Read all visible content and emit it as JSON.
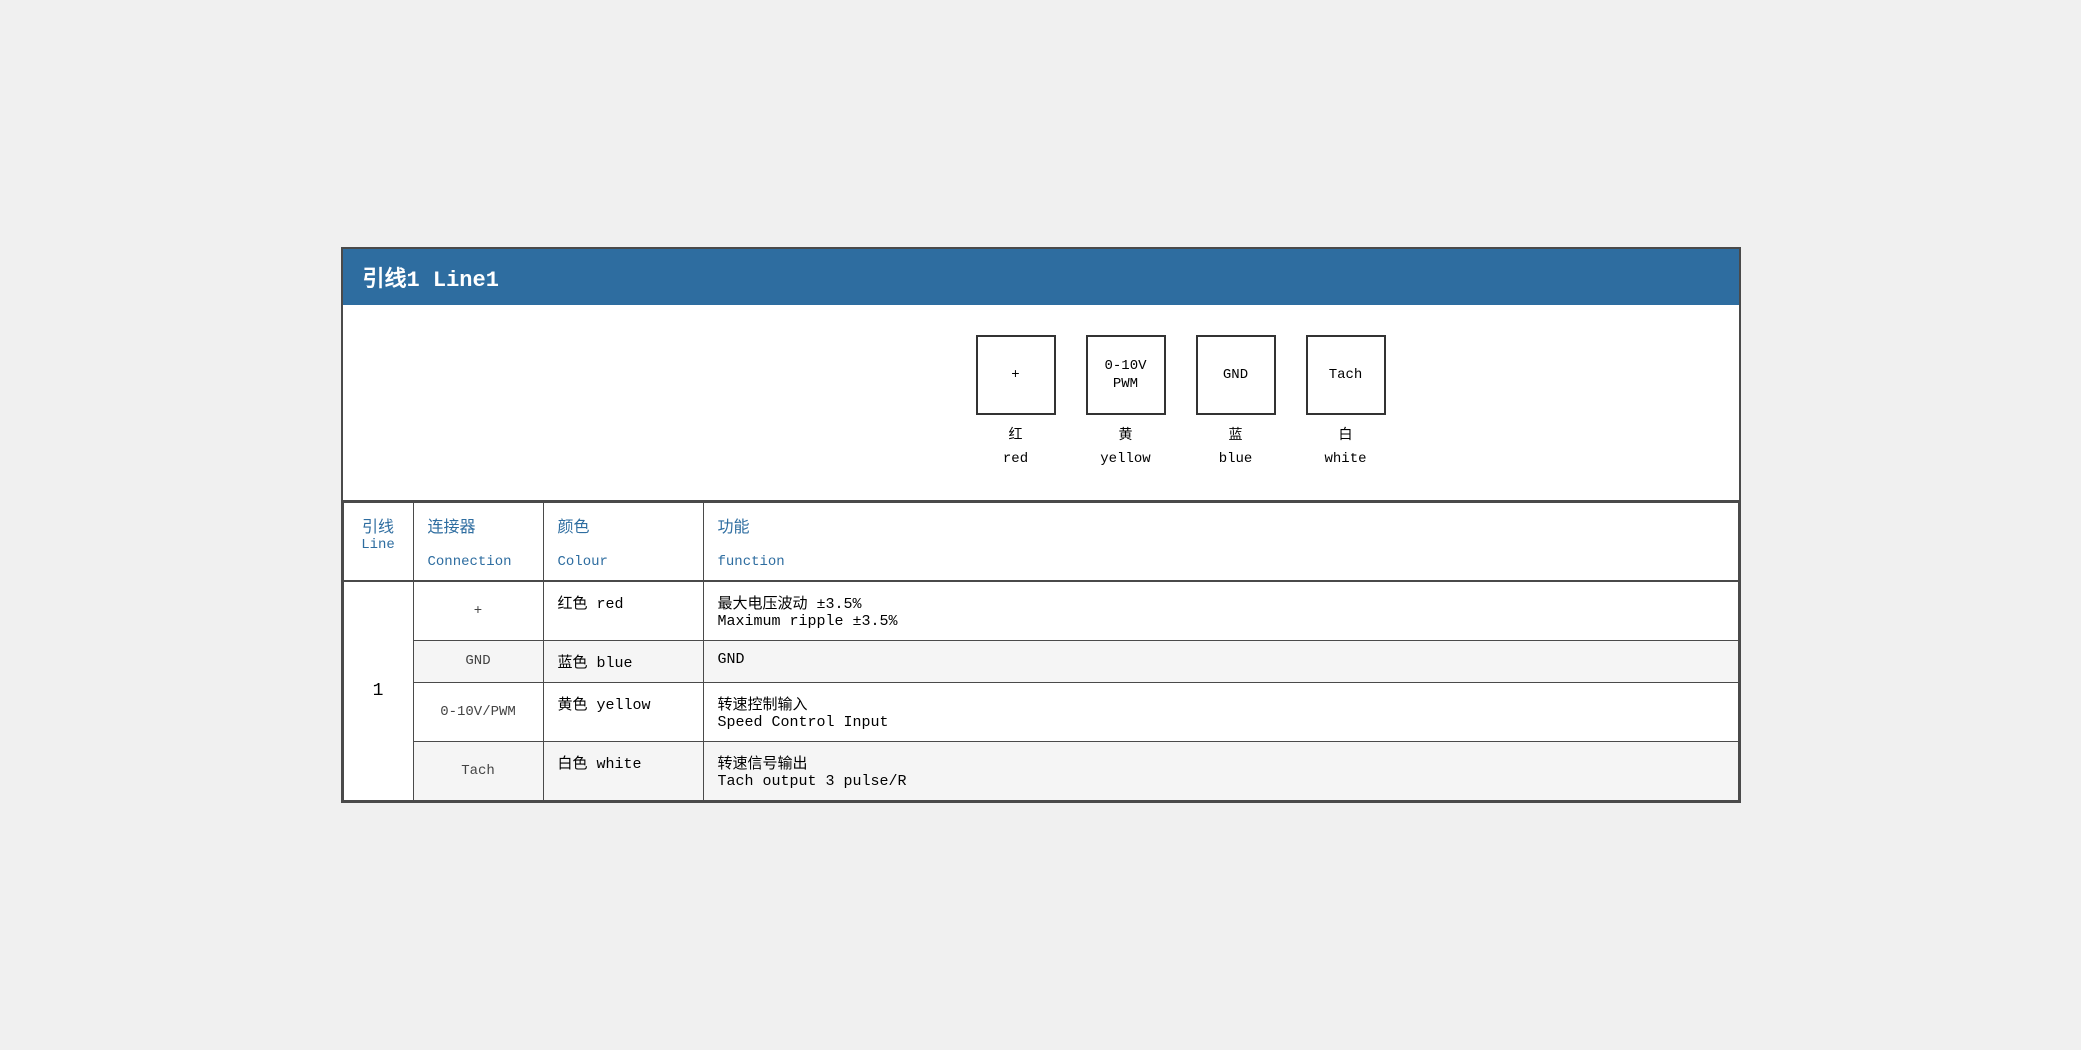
{
  "header": {
    "title": "引线1 Line1"
  },
  "diagram": {
    "boxes": [
      {
        "id": "plus-box",
        "label": "+"
      },
      {
        "id": "pwm-box",
        "label": "0-10V\nPWM"
      },
      {
        "id": "gnd-box",
        "label": "GND"
      },
      {
        "id": "tach-box",
        "label": "Tach"
      }
    ],
    "labels": [
      {
        "id": "red-label",
        "zh": "红",
        "en": "red"
      },
      {
        "id": "yellow-label",
        "zh": "黄",
        "en": "yellow"
      },
      {
        "id": "blue-label",
        "zh": "蓝",
        "en": "blue"
      },
      {
        "id": "white-label",
        "zh": "白",
        "en": "white"
      }
    ]
  },
  "table": {
    "headers": {
      "line_zh": "引线",
      "line_en": "Line",
      "connection_zh": "连接器",
      "connection_en": "Connection",
      "colour_zh": "颜色",
      "colour_en": "Colour",
      "function_zh": "功能",
      "function_en": "function"
    },
    "rows": [
      {
        "line": "1",
        "rowspan": 4,
        "connection": "+",
        "colour_zh": "红色",
        "colour_en": "red",
        "function_zh": "最大电压波动 ±3.5%",
        "function_en": "Maximum ripple ±3.5%"
      },
      {
        "connection": "GND",
        "colour_zh": "蓝色",
        "colour_en": "blue",
        "function_zh": "GND",
        "function_en": ""
      },
      {
        "connection": "0-10V/PWM",
        "colour_zh": "黄色",
        "colour_en": "yellow",
        "function_zh": "转速控制输入",
        "function_en": "Speed Control Input"
      },
      {
        "connection": "Tach",
        "colour_zh": "白色",
        "colour_en": "white",
        "function_zh": "转速信号输出",
        "function_en": "Tach output 3 pulse/R"
      }
    ]
  }
}
